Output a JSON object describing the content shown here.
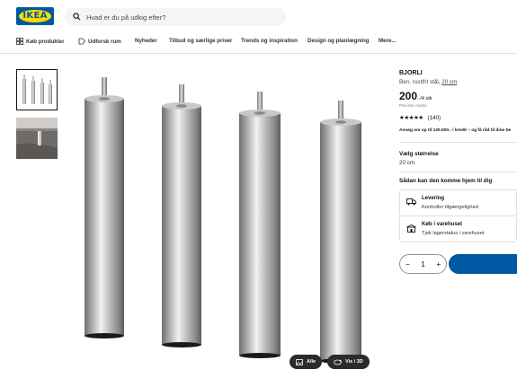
{
  "header": {
    "logo_text": "IKEA",
    "search_placeholder": "Hvad er du på udkig efter?"
  },
  "nav": {
    "items": [
      {
        "label": "Køb produkter",
        "icon": "grid-icon"
      },
      {
        "label": "Udforsk rum",
        "icon": "tag-icon"
      },
      {
        "label": "Nyheder"
      },
      {
        "label": "Tilbud og særlige priser"
      },
      {
        "label": "Trends og inspiration"
      },
      {
        "label": "Design og planlægning"
      },
      {
        "label": "Mere..."
      }
    ]
  },
  "gallery": {
    "badges": {
      "all_label": "Alle",
      "view3d_label": "Vis i 3D"
    }
  },
  "product": {
    "name": "BJORLI",
    "description": "Ben, rustfrit stål,",
    "size_link": "20 cm",
    "price": "200",
    "price_unit": ".-/4 stk",
    "price_note": "Pris inkl. moms",
    "stars": "★★★★★",
    "review_count": "(140)",
    "credit_text": "Ansøg om op til 130.000.- i kredit – og få råd til dine be",
    "size_label": "Vælg størrelse",
    "size_value": "20 cm",
    "delivery_heading": "Sådan kan den komme hjem til dig",
    "delivery": {
      "title": "Levering",
      "subtitle": "Kontroller tilgængelighed",
      "icon": "truck-icon"
    },
    "store": {
      "title": "Køb i varehuset",
      "subtitle": "Tjek lagerstatus i varehuset",
      "icon": "store-icon"
    },
    "quantity": {
      "minus": "−",
      "value": "1",
      "plus": "+"
    }
  },
  "colors": {
    "ikea_blue": "#0058a3",
    "ikea_yellow": "#ffdb00"
  }
}
